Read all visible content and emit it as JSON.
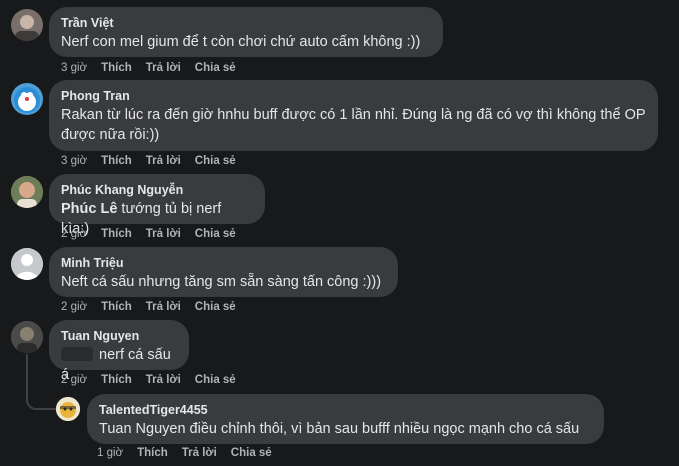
{
  "comments": [
    {
      "name": "Trần Việt",
      "text": "Nerf con mel gium để t còn chơi chứ auto cấm không :))",
      "time": "3 giờ"
    },
    {
      "name": "Phong Tran",
      "text": "Rakan từ lúc ra đến giờ hnhu buff được có 1 lần nhỉ. Đúng là ng đã có vợ thì không thể OP được nữa rồi:))",
      "time": "3 giờ"
    },
    {
      "name": "Phúc Khang Nguyễn",
      "mention": "Phúc Lê",
      "text": " tướng tủ bị nerf kìa:)",
      "time": "2 giờ"
    },
    {
      "name": "Minh Triệu",
      "text": "Neft cá sấu nhưng tăng sm sẵn sàng tấn công :)))",
      "time": "2 giờ"
    },
    {
      "name": "Tuan Nguyen",
      "text": "nerf cá sấu á",
      "time": "2 giờ"
    },
    {
      "name": "TalentedTiger4455",
      "text": "Tuan Nguyen điều chỉnh thôi, vì bản sau bufff nhiều ngọc mạnh cho cá sấu",
      "time": "1 giờ"
    }
  ],
  "actions": {
    "like": "Thích",
    "reply": "Trả lời",
    "share": "Chia sẻ"
  },
  "colors": {
    "background": "#18191a",
    "bubble": "#3a3b3c",
    "text": "#e4e6eb",
    "muted": "#b0b3b8"
  }
}
